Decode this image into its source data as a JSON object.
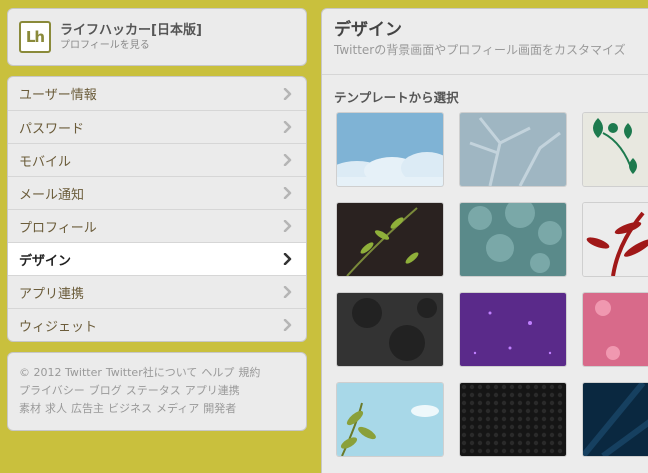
{
  "profile": {
    "avatar_text": "Lh",
    "name": "ライフハッカー[日本版]",
    "link": "プロフィールを見る"
  },
  "nav": {
    "items": [
      {
        "label": "ユーザー情報",
        "active": false
      },
      {
        "label": "パスワード",
        "active": false
      },
      {
        "label": "モバイル",
        "active": false
      },
      {
        "label": "メール通知",
        "active": false
      },
      {
        "label": "プロフィール",
        "active": false
      },
      {
        "label": "デザイン",
        "active": true
      },
      {
        "label": "アプリ連携",
        "active": false
      },
      {
        "label": "ウィジェット",
        "active": false
      }
    ]
  },
  "footer": {
    "links": [
      "© 2012 Twitter",
      "Twitter社について",
      "ヘルプ",
      "規約",
      "プライバシー",
      "ブログ",
      "ステータス",
      "アプリ連携",
      "素材",
      "求人",
      "広告主",
      "ビジネス",
      "メディア",
      "開発者"
    ]
  },
  "main": {
    "title": "デザイン",
    "description": "Twitterの背景画面やプロフィール画面をカスタマイズ",
    "section_title": "テンプレートから選択"
  },
  "templates": [
    {
      "name": "clouds",
      "color": "#7fb3d5"
    },
    {
      "name": "branches",
      "color": "#9fb6c2"
    },
    {
      "name": "vines",
      "color": "#e8e8e0"
    },
    {
      "name": "leaves-dark",
      "color": "#2a2220"
    },
    {
      "name": "foliage-teal",
      "color": "#5a8a8a"
    },
    {
      "name": "red-plant",
      "color": "#ececec"
    },
    {
      "name": "dark-texture",
      "color": "#333333"
    },
    {
      "name": "purple-sparkle",
      "color": "#5a2a8a"
    },
    {
      "name": "pink-flowers",
      "color": "#d86a8a"
    },
    {
      "name": "leaves-sky",
      "color": "#a8d8e8"
    },
    {
      "name": "black-hex",
      "color": "#1a1a1a"
    },
    {
      "name": "dark-blue-rays",
      "color": "#0a2840"
    }
  ],
  "colors": {
    "background": "#c9c03d",
    "nav_text": "#6b5c3a",
    "active_bg": "#ffffff"
  }
}
